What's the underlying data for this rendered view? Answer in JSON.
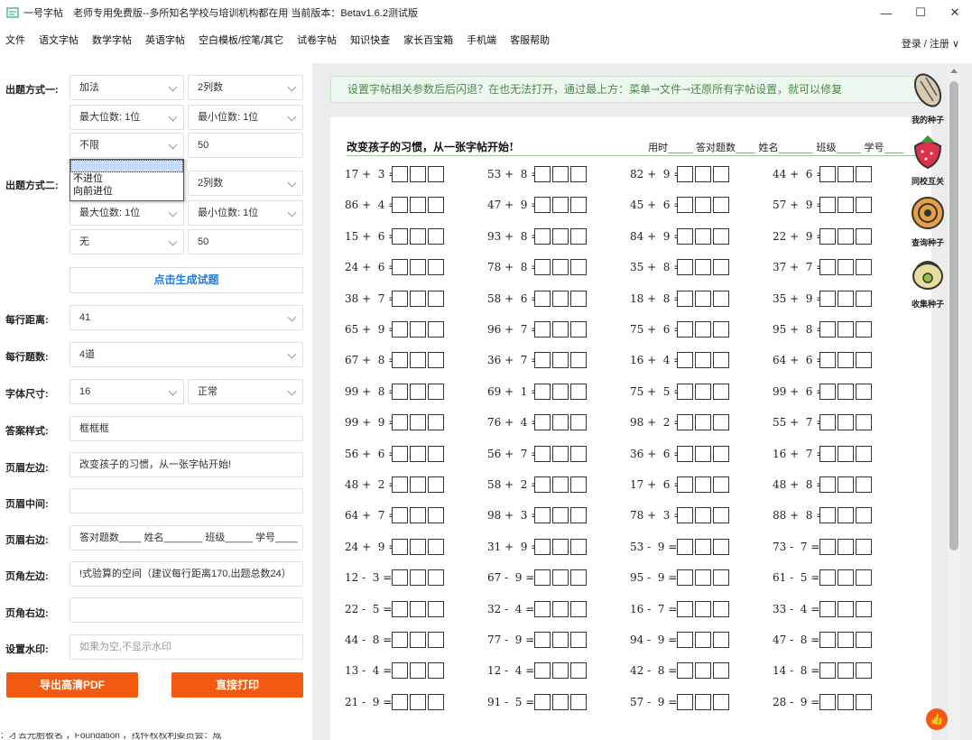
{
  "titlebar": {
    "title": "一号字帖　老师专用免费版--多所知名学校与培训机构都在用 当前版本：Betav1.6.2测试版",
    "minimize": "—",
    "maximize": "☐",
    "close": "✕"
  },
  "menu": {
    "items": [
      "文件",
      "语文字帖",
      "数学字帖",
      "英语字帖",
      "空白模板/控笔/其它",
      "试卷字帖",
      "知识快查",
      "家长百宝箱",
      "手机端",
      "客服帮助"
    ],
    "login": "登录 / 注册 ∨"
  },
  "form": {
    "mode1_label": "出题方式一:",
    "mode1_op": "加法",
    "mode1_cols": "2列数",
    "mode1_max": "最大位数: 1位",
    "mode1_min": "最小位数: 1位",
    "mode1_carry": "不限",
    "mode1_count": "50",
    "dropdown_options": [
      "不限",
      "不进位",
      "向前进位"
    ],
    "mode2_label": "出题方式二:",
    "mode2_cols": "2列数",
    "mode2_max": "最大位数: 1位",
    "mode2_min": "最小位数: 1位",
    "mode2_carry": "无",
    "mode2_count": "50",
    "generate": "点击生成试题",
    "line_spacing_label": "每行距离:",
    "line_spacing": "41",
    "per_row_label": "每行题数:",
    "per_row": "4道",
    "font_size_label": "字体尺寸:",
    "font_size": "16",
    "font_style": "正常",
    "answer_style_label": "答案样式:",
    "answer_style": "框框框",
    "header_left_label": "页眉左边:",
    "header_left": "改变孩子的习惯，从一张字帖开始!",
    "header_mid_label": "页眉中间:",
    "header_mid": "",
    "header_right_label": "页眉右边:",
    "header_right": "答对题数____ 姓名_______ 班级_____ 学号____",
    "footer_left_label": "页角左边:",
    "footer_left": "!式验算的空间（建议每行距离170,出题总数24）",
    "footer_right_label": "页角右边:",
    "footer_right": "",
    "watermark_label": "设置水印:",
    "watermark_placeholder": "如果为空,不显示水印",
    "export_pdf": "导出高清PDF",
    "print": "直接打印"
  },
  "preview": {
    "notice": "设置字帖相关参数后后闪退？在也无法打开，通过最上方：菜单→文件→还原所有字帖设置，就可以修复",
    "paper_title": "改变孩子的习惯，从一张字帖开始!",
    "paper_right": "用时_____ 答对题数____ 姓名_______ 班级_____ 学号____",
    "problems": [
      [
        "17 +  3 =",
        "53 +  8 =",
        "82 +  9 =",
        "44 +  6 ="
      ],
      [
        "86 +  4 =",
        "47 +  9 =",
        "45 +  6 =",
        "57 +  9 ="
      ],
      [
        "15 +  6 =",
        "93 +  8 =",
        "84 +  9 =",
        "22 +  9 ="
      ],
      [
        "24 +  6 =",
        "78 +  8 =",
        "35 +  8 =",
        "37 +  7 ="
      ],
      [
        "38 +  7 =",
        "58 +  6 =",
        "18 +  8 =",
        "35 +  9 ="
      ],
      [
        "65 +  9 =",
        "96 +  7 =",
        "75 +  6 =",
        "95 +  8 ="
      ],
      [
        "67 +  8 =",
        "36 +  7 =",
        "16 +  4 =",
        "64 +  6 ="
      ],
      [
        "99 +  8 =",
        "69 +  1 =",
        "75 +  5 =",
        "99 +  6 ="
      ],
      [
        "99 +  9 =",
        "76 +  4 =",
        "98 +  2 =",
        "55 +  7 ="
      ],
      [
        "56 +  6 =",
        "56 +  7 =",
        "36 +  6 =",
        "16 +  7 ="
      ],
      [
        "48 +  2 =",
        "58 +  2 =",
        "17 +  6 =",
        "48 +  8 ="
      ],
      [
        "64 +  7 =",
        "98 +  3 =",
        "78 +  3 =",
        "88 +  8 ="
      ],
      [
        "24 +  9 =",
        "31 +  9 =",
        "53 -  9 =",
        "73 -  7 ="
      ],
      [
        "12 -  3 =",
        "67 -  9 =",
        "95 -  9 =",
        "61 -  5 ="
      ],
      [
        "22 -  5 =",
        "32 -  4 =",
        "16 -  7 =",
        "33 -  4 ="
      ],
      [
        "44 -  8 =",
        "77 -  9 =",
        "94 -  9 =",
        "47 -  8 ="
      ],
      [
        "13 -  4 =",
        "12 -  4 =",
        "42 -  8 =",
        "14 -  8 ="
      ],
      [
        "21 -  9 =",
        "91 -  5 =",
        "57 -  9 =",
        "28 -  9 ="
      ]
    ],
    "side_icons": [
      "我的种子",
      "同校互关",
      "查询种子",
      "收集种子"
    ],
    "bottom_text": "：才去元胎板名 ，Foundation ，找件权权利委员会：成"
  },
  "colors": {
    "accent_orange": "#f25a12",
    "link_blue": "#1f7ae0",
    "notice_green": "#4a8a4a"
  }
}
